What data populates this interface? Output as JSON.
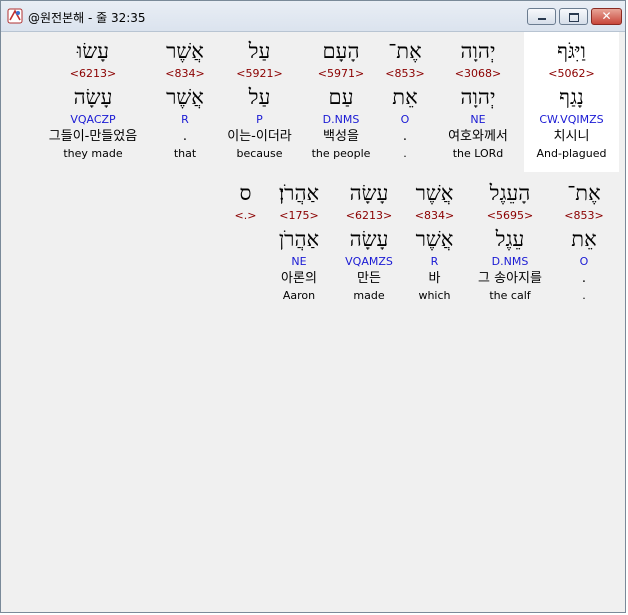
{
  "window": {
    "title": "@원전본해 - 줄 32:35",
    "close_glyph": "✕"
  },
  "verse": {
    "rows": [
      {
        "words": [
          {
            "heb": "וַיִּגֹּף",
            "strong": "<5062>",
            "heb_lemma": "נָגַף",
            "parse": "CW.VQIMZS",
            "kor": "치시니",
            "eng": "And-plagued",
            "highlight": true
          },
          {
            "heb": "יְהוָה",
            "strong": "<3068>",
            "heb_lemma": "יְהוָה",
            "parse": "NE",
            "kor": "여호와께서",
            "eng": "the LORd"
          },
          {
            "heb": "אֶת־",
            "strong": "<853>",
            "heb_lemma": "אֵת",
            "parse": "O",
            "kor": ".",
            "eng": "."
          },
          {
            "heb": "הָעָם",
            "strong": "<5971>",
            "heb_lemma": "עַם",
            "parse": "D.NMS",
            "kor": "백성을",
            "eng": "the people"
          },
          {
            "heb": "עַל",
            "strong": "<5921>",
            "heb_lemma": "עַל",
            "parse": "P",
            "kor": "이는-이더라",
            "eng": "because"
          },
          {
            "heb": "אֲשֶׁר",
            "strong": "<834>",
            "heb_lemma": "אֲשֶׁר",
            "parse": "R",
            "kor": ".",
            "eng": "that"
          },
          {
            "heb": "עָשׂוּ",
            "strong": "<6213>",
            "heb_lemma": "עָשָׂה",
            "parse": "VQACZP",
            "kor": "그들이-만들었음",
            "eng": "they made"
          }
        ]
      },
      {
        "words": [
          {
            "heb": "אֶת־",
            "strong": "<853>",
            "heb_lemma": "אֵת",
            "parse": "O",
            "kor": ".",
            "eng": "."
          },
          {
            "heb": "הָעֵגֶל",
            "strong": "<5695>",
            "heb_lemma": "עֵגֶל",
            "parse": "D.NMS",
            "kor": "그 송아지를",
            "eng": "the calf"
          },
          {
            "heb": "אֲשֶׁר",
            "strong": "<834>",
            "heb_lemma": "אֲשֶׁר",
            "parse": "R",
            "kor": "바",
            "eng": "which"
          },
          {
            "heb": "עָשָׂה",
            "strong": "<6213>",
            "heb_lemma": "עָשָׂה",
            "parse": "VQAMZS",
            "kor": "만든",
            "eng": "made"
          },
          {
            "heb": "אַהֲרֹן׃",
            "strong": "<175>",
            "heb_lemma": "אַהֲרֹן",
            "parse": "NE",
            "kor": "아론의",
            "eng": "Aaron"
          },
          {
            "heb": "ס",
            "strong": "<.>",
            "heb_lemma": "",
            "parse": "",
            "kor": "",
            "eng": ""
          }
        ]
      }
    ]
  }
}
